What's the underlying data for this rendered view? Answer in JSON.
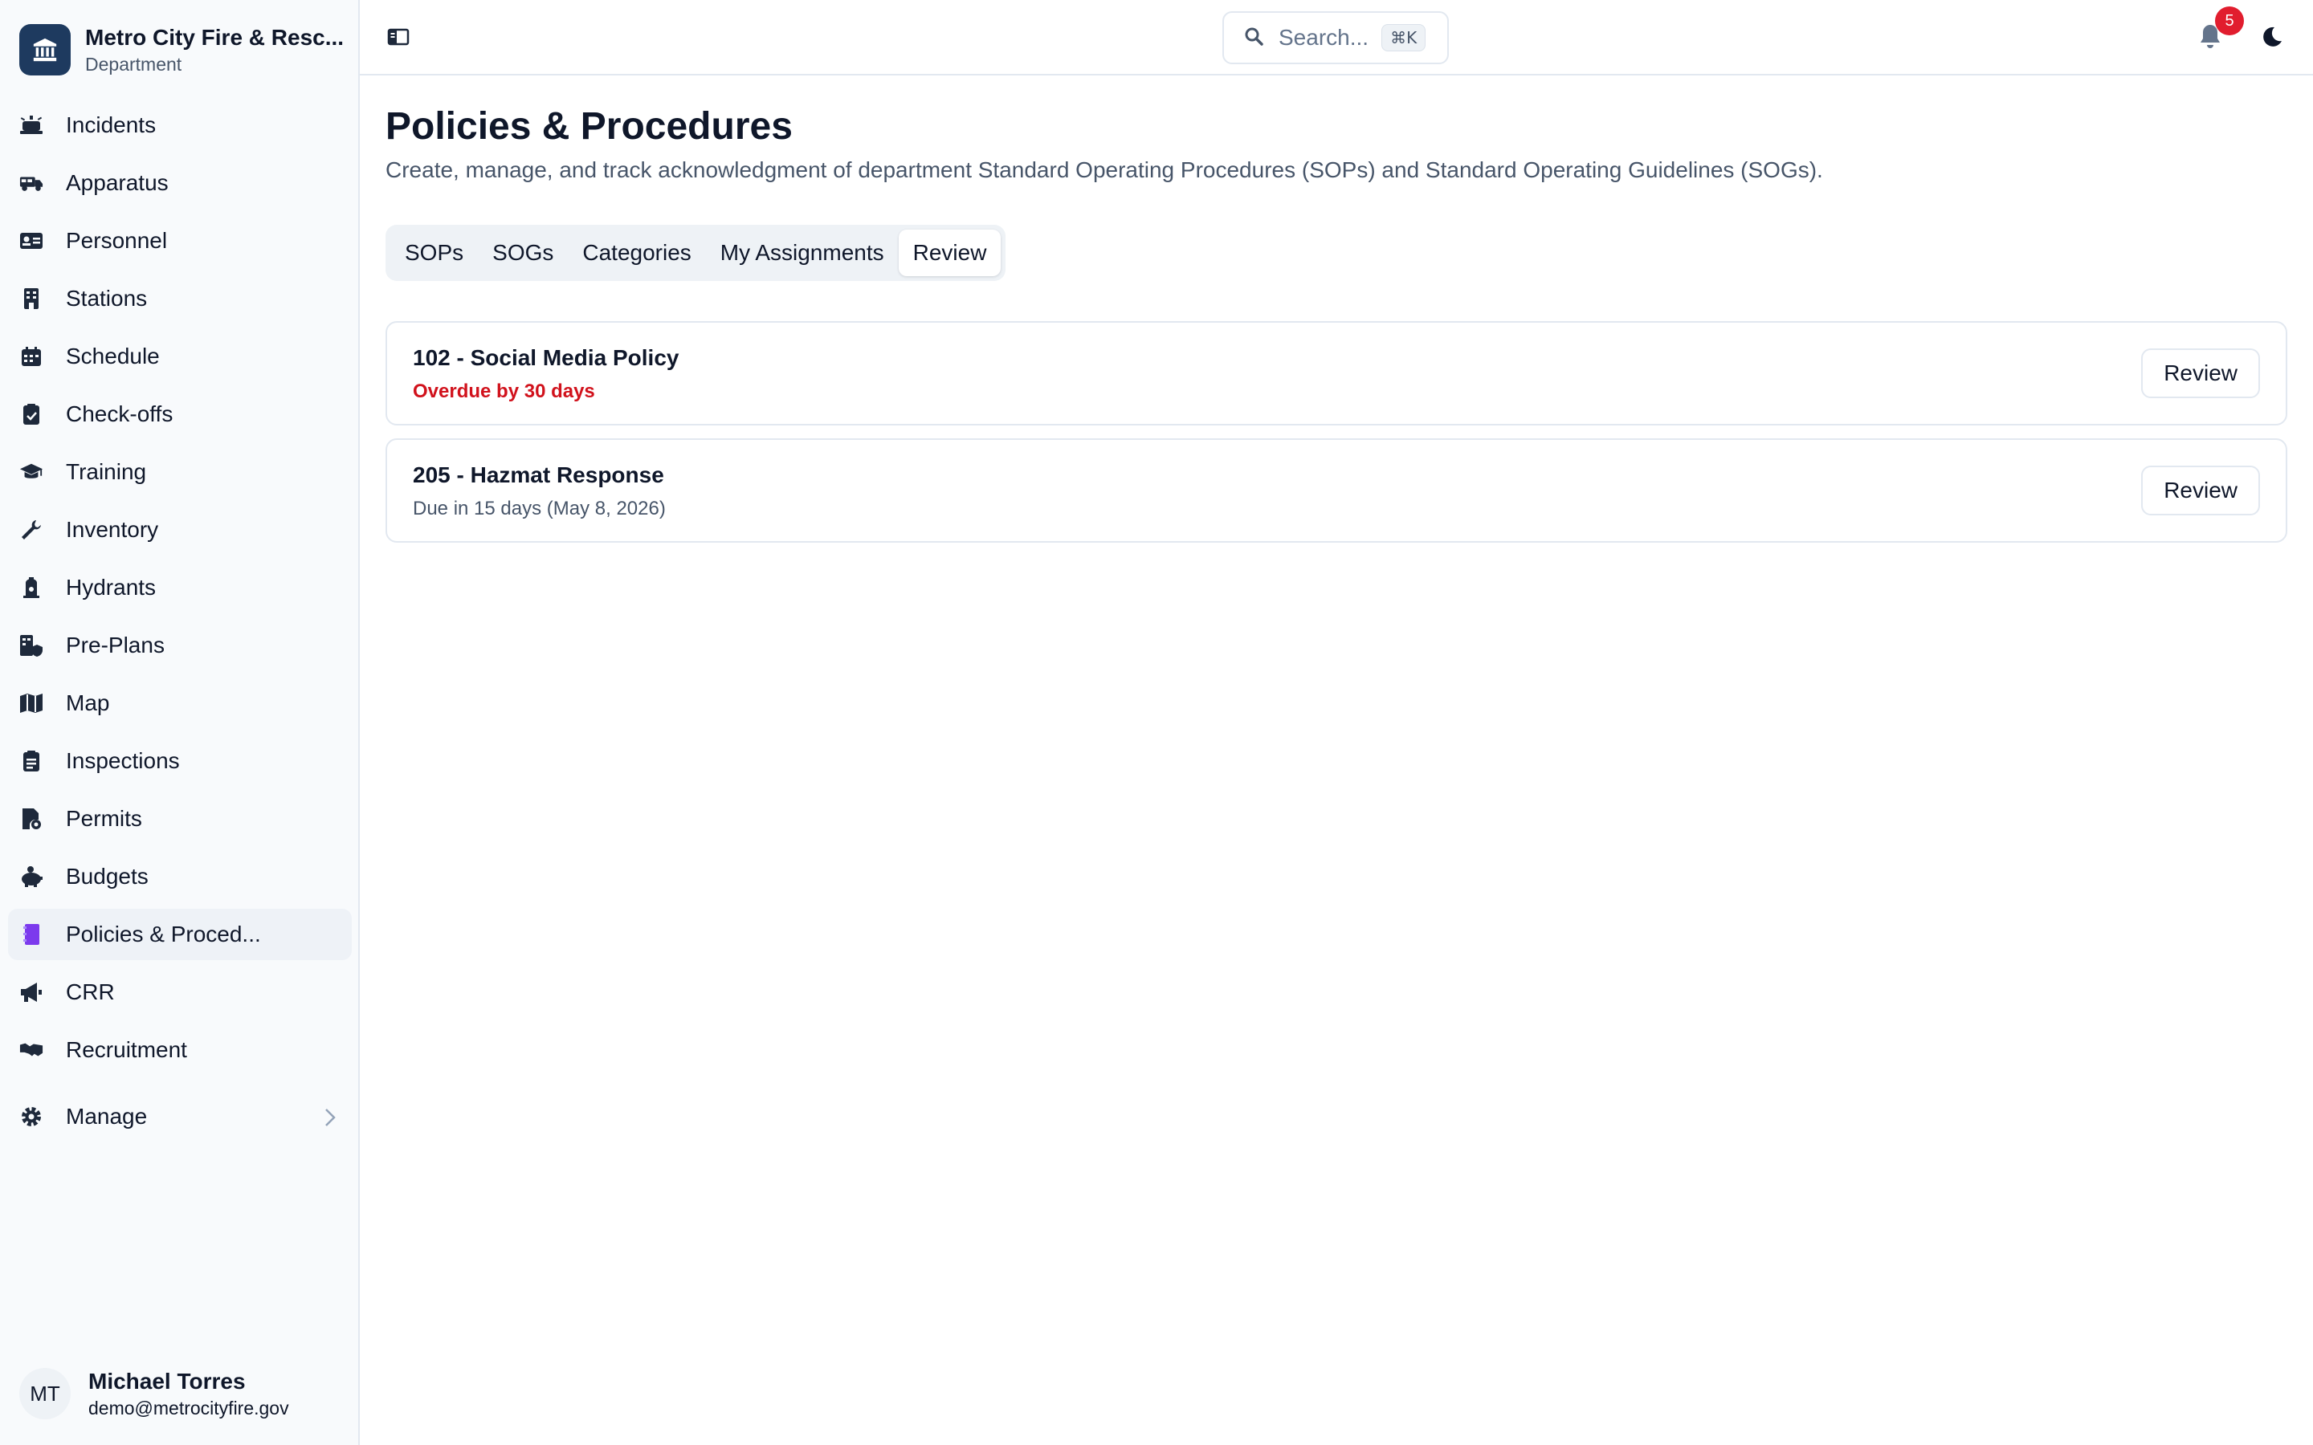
{
  "brand": {
    "name": "Metro City Fire & Resc...",
    "subtitle": "Department"
  },
  "sidebar": {
    "items": [
      {
        "label": "Incidents",
        "icon": "siren-icon"
      },
      {
        "label": "Apparatus",
        "icon": "truck-icon"
      },
      {
        "label": "Personnel",
        "icon": "id-card-icon"
      },
      {
        "label": "Stations",
        "icon": "building-icon"
      },
      {
        "label": "Schedule",
        "icon": "calendar-icon"
      },
      {
        "label": "Check-offs",
        "icon": "clipboard-check-icon"
      },
      {
        "label": "Training",
        "icon": "graduation-cap-icon"
      },
      {
        "label": "Inventory",
        "icon": "wrench-icon"
      },
      {
        "label": "Hydrants",
        "icon": "hydrant-icon"
      },
      {
        "label": "Pre-Plans",
        "icon": "building-shield-icon"
      },
      {
        "label": "Map",
        "icon": "map-icon"
      },
      {
        "label": "Inspections",
        "icon": "clipboard-list-icon"
      },
      {
        "label": "Permits",
        "icon": "permit-icon"
      },
      {
        "label": "Budgets",
        "icon": "piggy-bank-icon"
      },
      {
        "label": "Policies & Proced...",
        "icon": "book-icon",
        "active": true
      },
      {
        "label": "CRR",
        "icon": "megaphone-icon"
      },
      {
        "label": "Recruitment",
        "icon": "handshake-icon"
      }
    ],
    "manage_label": "Manage"
  },
  "user": {
    "initials": "MT",
    "name": "Michael Torres",
    "email": "demo@metrocityfire.gov"
  },
  "topbar": {
    "search_placeholder": "Search...",
    "search_shortcut": "⌘K",
    "notification_count": "5"
  },
  "page": {
    "title": "Policies & Procedures",
    "description": "Create, manage, and track acknowledgment of department Standard Operating Procedures (SOPs) and Standard Operating Guidelines (SOGs)."
  },
  "tabs": [
    {
      "label": "SOPs"
    },
    {
      "label": "SOGs"
    },
    {
      "label": "Categories"
    },
    {
      "label": "My Assignments"
    },
    {
      "label": "Review",
      "active": true
    }
  ],
  "reviews": [
    {
      "title": "102 - Social Media Policy",
      "status": "Overdue by 30 days",
      "status_type": "overdue",
      "button": "Review"
    },
    {
      "title": "205 - Hazmat Response",
      "status": "Due in 15 days (May 8, 2026)",
      "status_type": "due",
      "button": "Review"
    }
  ],
  "colors": {
    "brand_logo": "#1e3a5f",
    "overdue": "#d1121c",
    "badge": "#e11d2e",
    "active_nav": "#eef2f7",
    "policies_icon": "#7c3aed"
  }
}
